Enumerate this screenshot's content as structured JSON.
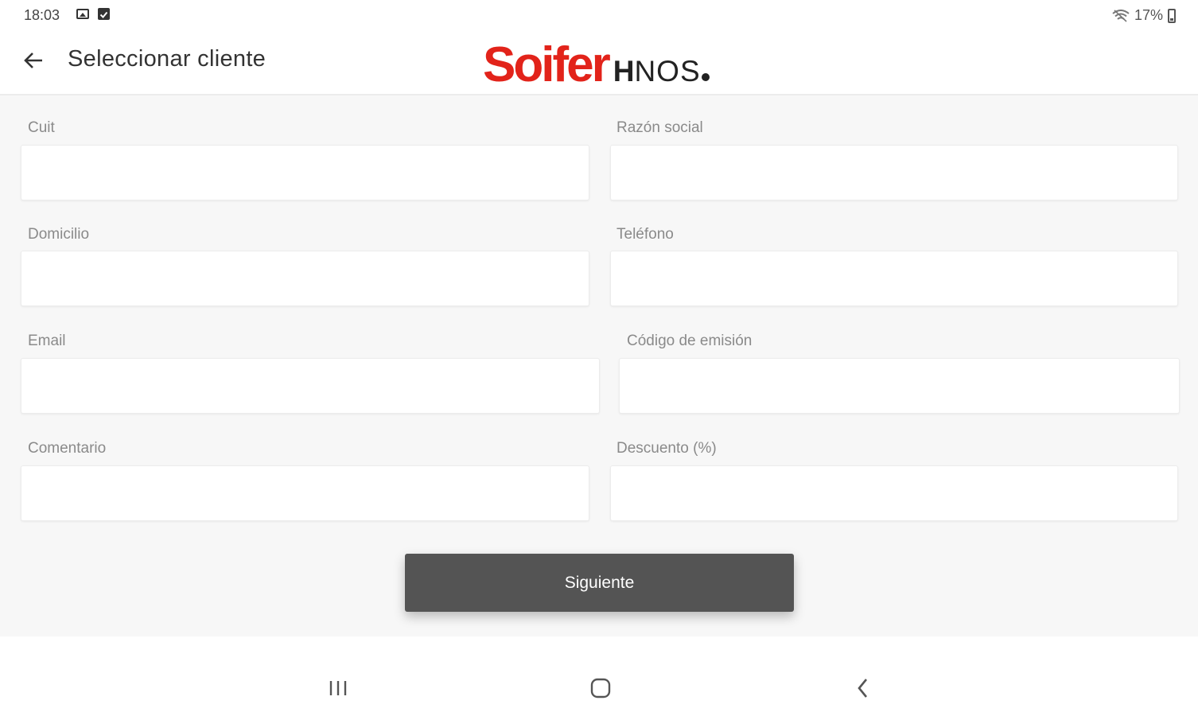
{
  "status_bar": {
    "time": "18:03",
    "battery": "17%",
    "icons": [
      "image-icon",
      "check-square-icon",
      "wifi-icon",
      "battery-icon"
    ]
  },
  "app_bar": {
    "title": "Seleccionar cliente",
    "back_icon": "arrow-left-icon",
    "logo": {
      "main": "Soifer",
      "h": "H",
      "rest": "NOS"
    }
  },
  "form": {
    "fields": [
      {
        "label": "Cuit",
        "value": ""
      },
      {
        "label": "Razón social",
        "value": ""
      },
      {
        "label": "Domicilio",
        "value": ""
      },
      {
        "label": "Teléfono",
        "value": ""
      },
      {
        "label": "Email",
        "value": ""
      },
      {
        "label": "Código de emisión",
        "value": ""
      },
      {
        "label": "Comentario",
        "value": ""
      },
      {
        "label": "Descuento (%)",
        "value": ""
      }
    ],
    "submit_label": "Siguiente"
  },
  "nav_bar": {
    "icons": [
      "recent-apps-icon",
      "home-icon",
      "back-icon"
    ]
  },
  "colors": {
    "brand_red": "#e2231a",
    "button_bg": "#545454",
    "content_bg": "#f7f7f7"
  }
}
